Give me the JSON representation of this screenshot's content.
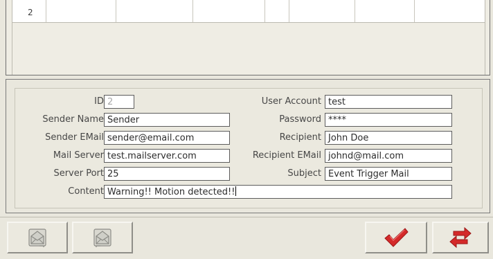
{
  "list": {
    "rows": [
      {
        "id": "2"
      }
    ]
  },
  "form": {
    "id_label": "ID",
    "id_value": "2",
    "sender_name_label": "Sender Name",
    "sender_name_value": "Sender",
    "sender_email_label": "Sender EMail",
    "sender_email_value": "sender@email.com",
    "mail_server_label": "Mail Server",
    "mail_server_value": "test.mailserver.com",
    "server_port_label": "Server Port",
    "server_port_value": "25",
    "content_label": "Content",
    "content_value": "Warning!! Motion detected!!",
    "user_account_label": "User Account",
    "user_account_value": "test",
    "password_label": "Password",
    "password_value": "****",
    "recipient_label": "Recipient",
    "recipient_value": "John Doe",
    "recipient_email_label": "Recipient EMail",
    "recipient_email_value": "johnd@mail.com",
    "subject_label": "Subject",
    "subject_value": "Event Trigger Mail"
  },
  "toolbar": {
    "buttons": [
      {
        "icon": "mail-send-icon"
      },
      {
        "icon": "mail-receive-icon"
      },
      {
        "icon": "checkmark-icon"
      },
      {
        "icon": "refresh-icon"
      }
    ]
  },
  "colors": {
    "background": "#e9e7dd",
    "confirm_red": "#d42a2a"
  }
}
